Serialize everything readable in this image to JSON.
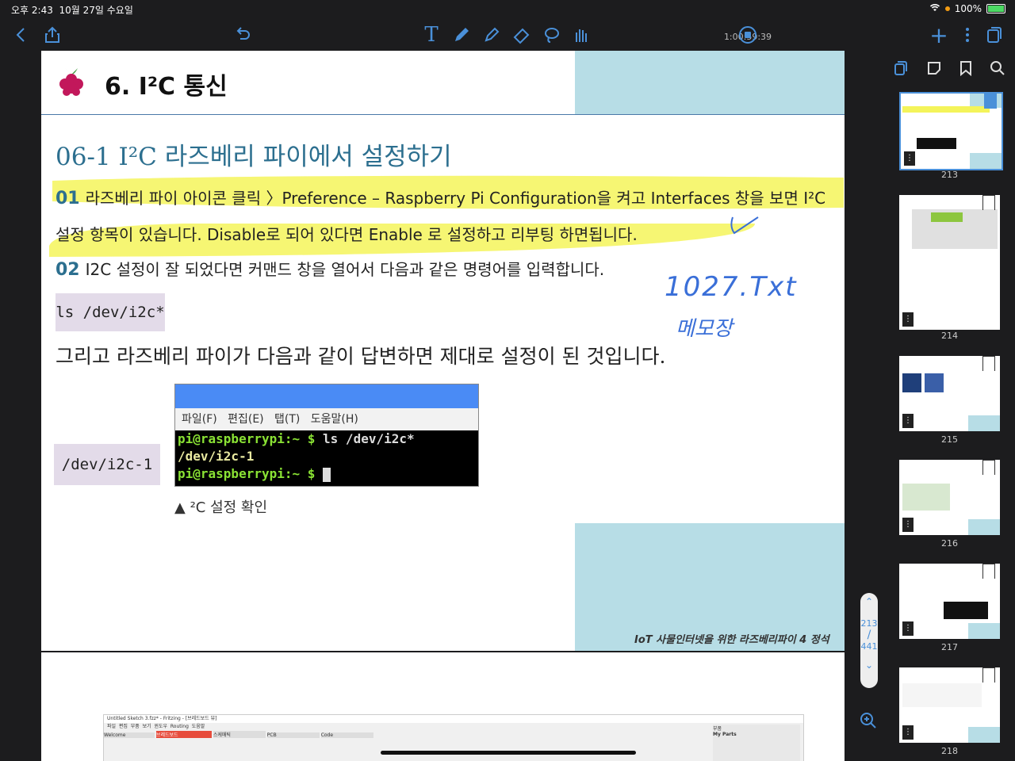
{
  "status": {
    "time": "오후 2:43",
    "date": "10월 27일 수요일",
    "battery": "100%"
  },
  "toolbar": {
    "timer": "1:00:59:39"
  },
  "page": {
    "chapter_title": "6. I²C 통신",
    "section_title": "06-1 I²C 라즈베리 파이에서 설정하기",
    "step1_num": "01",
    "step1_text": "라즈베리 파이 아이콘 클릭 〉Preference – Raspberry Pi Configuration을 켜고 Interfaces 창을 보면 I²C",
    "step1_text2": "설정 항목이 있습니다. Disable로 되어 있다면 Enable 로 설정하고 리부팅 하면됩니다.",
    "step2_num": "02",
    "step2_text": "I2C 설정이 잘 되었다면 커맨드 창을 열어서 다음과 같은 명령어를 입력합니다.",
    "command": "ls /dev/i2c*",
    "answer_text": "그리고 라즈베리 파이가 다음과 같이 답변하면 제대로 설정이 된 것입니다.",
    "output_box": "/dev/i2c-1",
    "terminal_menu": [
      "파일(F)",
      "편집(E)",
      "탭(T)",
      "도움말(H)"
    ],
    "terminal_prompt": "pi@raspberrypi:~ $",
    "terminal_cmd": "ls /dev/i2c*",
    "terminal_output": "/dev/i2c-1",
    "caption": "▲ ²C 설정 확인",
    "footer": "IoT 사물인터넷을 위한 라즈베리파이 4 정석",
    "handwriting1": "1027.Txt",
    "handwriting2": "메모장"
  },
  "page2": {
    "window_title": "Untitled Sketch 3.fzz* - Fritzing - [브레드보드 뷰]",
    "menu": [
      "파일",
      "편집",
      "부품",
      "보기",
      "윈도우",
      "Routing",
      "도움말"
    ],
    "tabs": [
      "Welcome",
      "브레드보드",
      "스케매틱",
      "PCB",
      "Code"
    ],
    "panel_label": "부품",
    "my_parts": "My Parts"
  },
  "sidebar": {
    "thumbs": [
      {
        "num": "213"
      },
      {
        "num": "214"
      },
      {
        "num": "215"
      },
      {
        "num": "216"
      },
      {
        "num": "217"
      },
      {
        "num": "218"
      }
    ]
  },
  "scroller": {
    "current": "213",
    "total": "441"
  }
}
